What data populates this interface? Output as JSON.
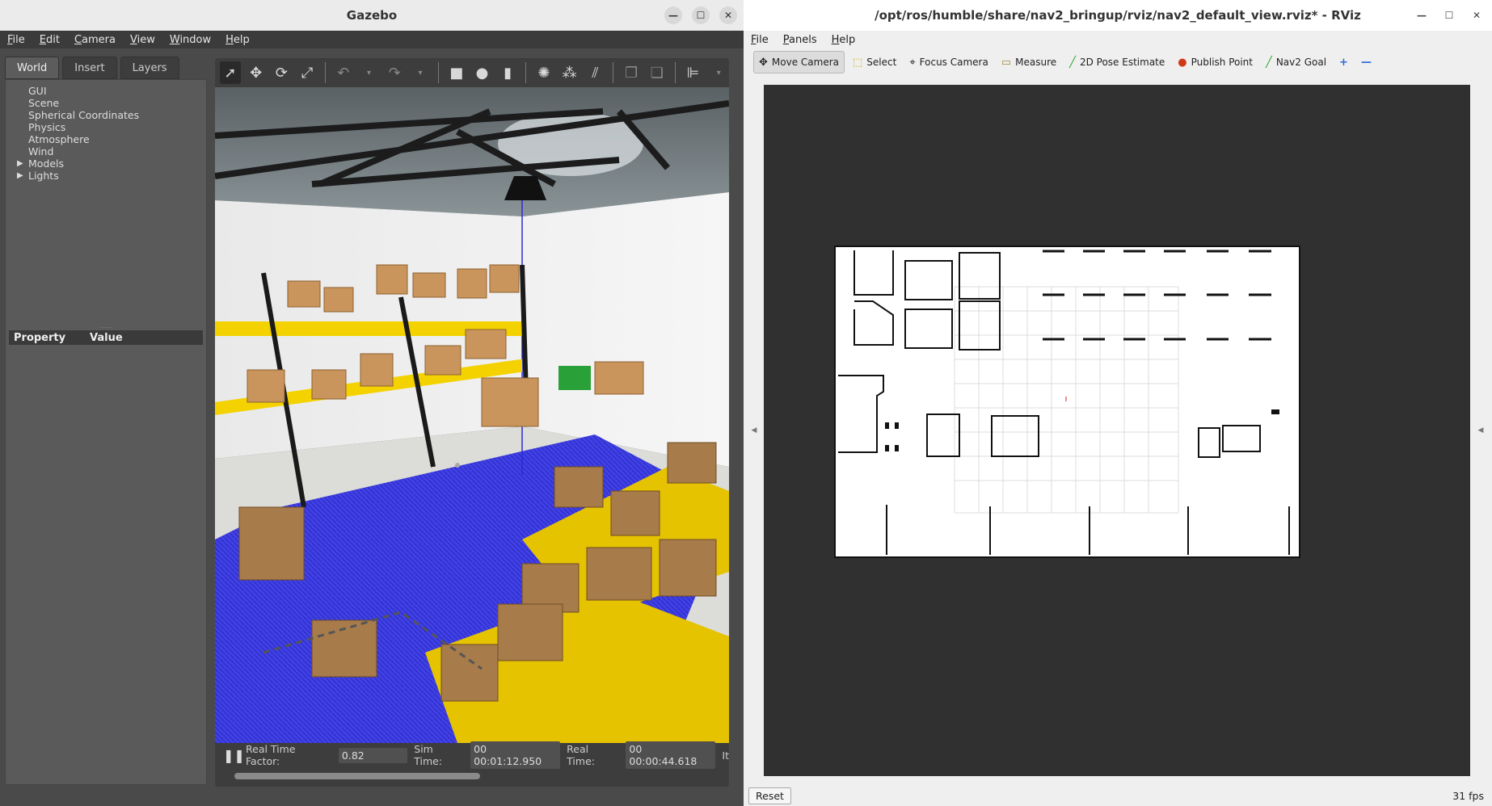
{
  "gazebo": {
    "title": "Gazebo",
    "menu": [
      "File",
      "Edit",
      "Camera",
      "View",
      "Window",
      "Help"
    ],
    "tabs": [
      "World",
      "Insert",
      "Layers"
    ],
    "tree": [
      "GUI",
      "Scene",
      "Spherical Coordinates",
      "Physics",
      "Atmosphere",
      "Wind",
      "Models",
      "Lights"
    ],
    "prop_header": {
      "property": "Property",
      "value": "Value"
    },
    "status": {
      "rtf_label": "Real Time Factor:",
      "rtf_value": "0.82",
      "sim_label": "Sim Time:",
      "sim_value": "00 00:01:12.950",
      "real_label": "Real Time:",
      "real_value": "00 00:00:44.618",
      "iter_label": "It"
    }
  },
  "rviz": {
    "title": "/opt/ros/humble/share/nav2_bringup/rviz/nav2_default_view.rviz* - RViz",
    "menu": [
      "File",
      "Panels",
      "Help"
    ],
    "tools": [
      {
        "label": "Move Camera",
        "icon": "move-camera-icon"
      },
      {
        "label": "Select",
        "icon": "select-icon"
      },
      {
        "label": "Focus Camera",
        "icon": "focus-camera-icon"
      },
      {
        "label": "Measure",
        "icon": "measure-icon"
      },
      {
        "label": "2D Pose Estimate",
        "icon": "pose-estimate-icon"
      },
      {
        "label": "Publish Point",
        "icon": "publish-point-icon"
      },
      {
        "label": "Nav2 Goal",
        "icon": "nav2-goal-icon"
      }
    ],
    "reset_label": "Reset",
    "fps": "31 fps"
  }
}
